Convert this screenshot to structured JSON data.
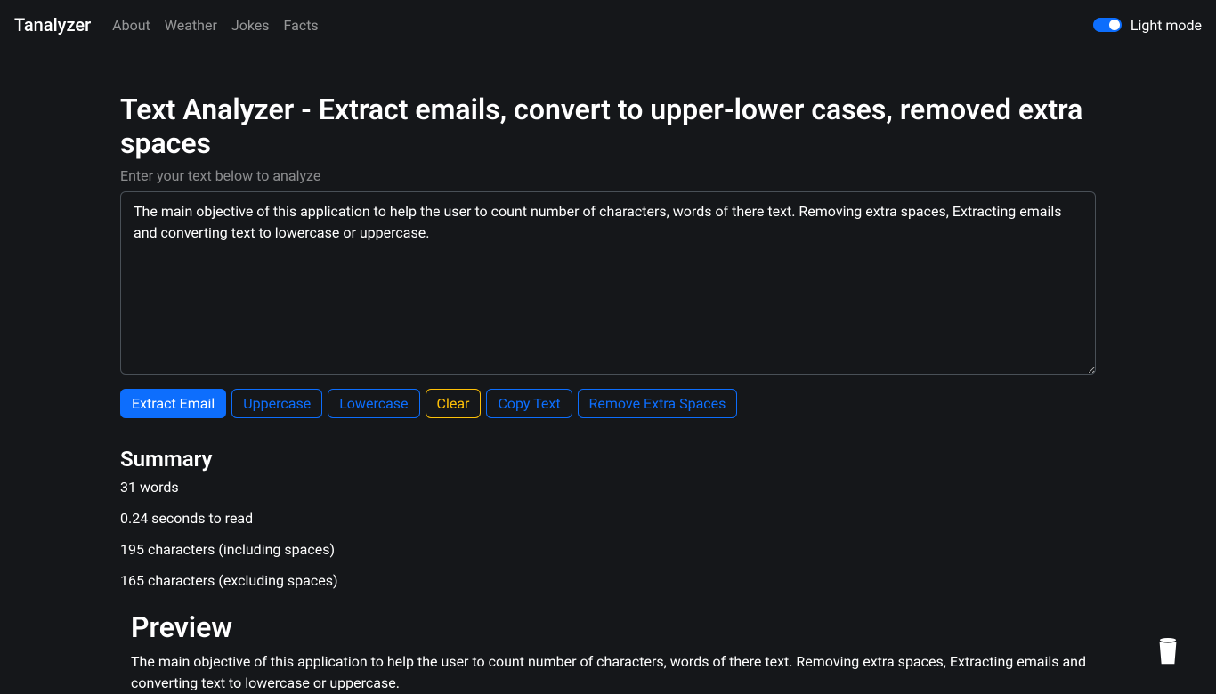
{
  "navbar": {
    "brand": "Tanalyzer",
    "links": [
      "About",
      "Weather",
      "Jokes",
      "Facts"
    ],
    "toggle_label": "Light mode"
  },
  "main": {
    "heading": "Text Analyzer - Extract emails, convert to upper-lower cases, removed extra spaces",
    "sub_label": "Enter your text below to analyze",
    "textarea_value": "The main objective of this application to help the user to count number of characters, words of there text. Removing extra spaces, Extracting emails and converting text to lowercase or uppercase."
  },
  "buttons": {
    "extract_email": "Extract Email",
    "uppercase": "Uppercase",
    "lowercase": "Lowercase",
    "clear": "Clear",
    "copy_text": "Copy Text",
    "remove_extra_spaces": "Remove Extra Spaces"
  },
  "summary": {
    "heading": "Summary",
    "words": "31 words",
    "read_time": "0.24 seconds to read",
    "chars_with_spaces": "195 characters (including spaces)",
    "chars_without_spaces": "165 characters (excluding spaces)"
  },
  "preview": {
    "heading": "Preview",
    "text": "The main objective of this application to help the user to count number of characters, words of there text. Removing extra spaces, Extracting emails and converting text to lowercase or uppercase."
  }
}
